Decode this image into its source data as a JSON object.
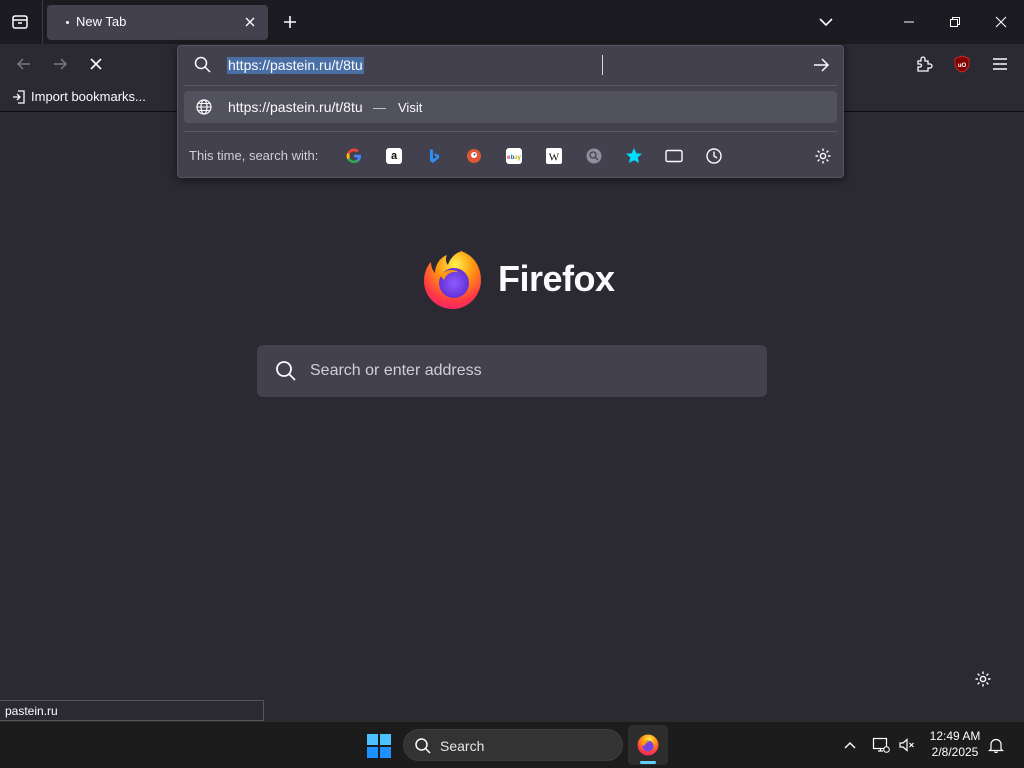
{
  "tab": {
    "title": "New Tab"
  },
  "toolbar": {
    "import_label": "Import bookmarks..."
  },
  "urlbar": {
    "value": "https://pastein.ru/t/8tu",
    "suggestion_url": "https://pastein.ru/t/8tu",
    "suggestion_sep": "—",
    "suggestion_action": "Visit",
    "engines_label": "This time, search with:",
    "engines": [
      "google-icon",
      "amazon-icon",
      "bing-icon",
      "duckduckgo-icon",
      "ebay-icon",
      "wikipedia-icon",
      "search-engine-icon",
      "bookmarks-star-icon",
      "tabs-icon",
      "history-icon"
    ]
  },
  "content": {
    "brand": "Firefox",
    "search_placeholder": "Search or enter address"
  },
  "status": {
    "text": "pastein.ru"
  },
  "taskbar": {
    "search_label": "Search",
    "time": "12:49 AM",
    "date": "2/8/2025"
  },
  "colors": {
    "accent": "#00ddff",
    "selection": "#4a6fa5",
    "ublock": "#800000"
  }
}
